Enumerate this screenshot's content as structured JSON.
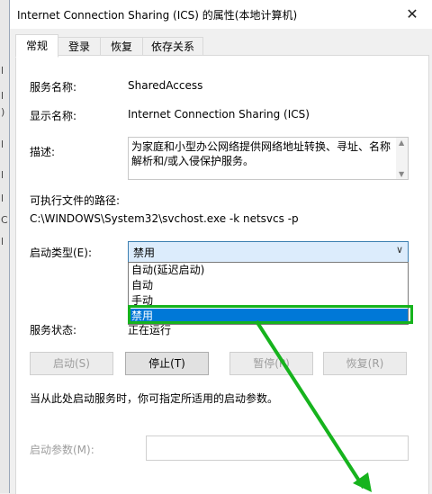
{
  "window": {
    "title": "Internet Connection Sharing (ICS) 的属性(本地计算机)",
    "close_glyph": "✕"
  },
  "tabs": [
    {
      "label": "常规",
      "active": true
    },
    {
      "label": "登录",
      "active": false
    },
    {
      "label": "恢复",
      "active": false
    },
    {
      "label": "依存关系",
      "active": false
    }
  ],
  "general": {
    "service_name_label": "服务名称:",
    "service_name_value": "SharedAccess",
    "display_name_label": "显示名称:",
    "display_name_value": "Internet Connection Sharing (ICS)",
    "description_label": "描述:",
    "description_value": "为家庭和小型办公网络提供网络地址转换、寻址、名称解析和/或入侵保护服务。",
    "exec_path_label": "可执行文件的路径:",
    "exec_path_value": "C:\\WINDOWS\\System32\\svchost.exe -k netsvcs -p",
    "startup_type_label": "启动类型(E):",
    "startup_type_value": "禁用",
    "startup_options": [
      "自动(延迟启动)",
      "自动",
      "手动",
      "禁用"
    ],
    "selected_option_index": 3,
    "service_status_label": "服务状态:",
    "service_status_value": "正在运行",
    "buttons": {
      "start": "启动(S)",
      "stop": "停止(T)",
      "pause": "暂停(P)",
      "resume": "恢复(R)"
    },
    "hint_text": "当从此处启动服务时，你可指定所适用的启动参数。",
    "start_params_label": "启动参数(M):",
    "start_params_value": ""
  },
  "annotation": {
    "highlight_color": "#16b31d"
  },
  "background_fragments": [
    "l",
    "l",
    ")",
    "l",
    "l",
    "l",
    "C",
    "l"
  ]
}
